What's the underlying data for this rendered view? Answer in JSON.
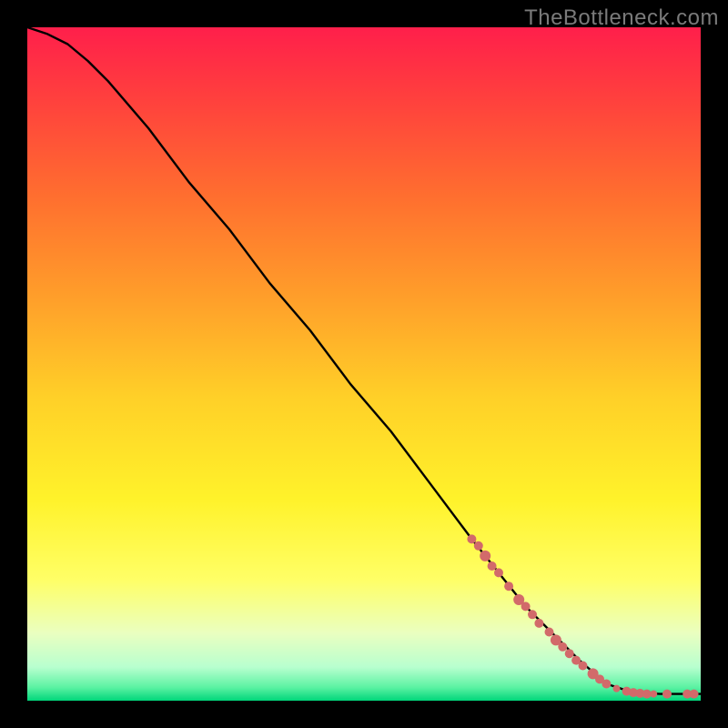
{
  "watermark": "TheBottleneck.com",
  "chart_data": {
    "type": "line",
    "title": "",
    "xlabel": "",
    "ylabel": "",
    "xlim": [
      0,
      100
    ],
    "ylim": [
      0,
      100
    ],
    "grid": false,
    "legend": false,
    "series": [
      {
        "name": "curve",
        "type": "line",
        "color": "#000000",
        "x": [
          0,
          3,
          6,
          9,
          12,
          18,
          24,
          30,
          36,
          42,
          48,
          54,
          60,
          66,
          70,
          74,
          78,
          82,
          86,
          90,
          94,
          97,
          100
        ],
        "y": [
          100,
          99,
          97.5,
          95,
          92,
          85,
          77,
          70,
          62,
          55,
          47,
          40,
          32,
          24,
          19,
          14,
          10,
          6,
          2.5,
          1.2,
          1.0,
          1.0,
          1.0
        ]
      },
      {
        "name": "markers",
        "type": "scatter",
        "color": "#d26a6a",
        "points": [
          {
            "x": 66.0,
            "y": 24.0,
            "r": 5
          },
          {
            "x": 67.0,
            "y": 23.0,
            "r": 5
          },
          {
            "x": 68.0,
            "y": 21.5,
            "r": 6
          },
          {
            "x": 69.0,
            "y": 20.0,
            "r": 5
          },
          {
            "x": 70.0,
            "y": 19.0,
            "r": 5
          },
          {
            "x": 71.5,
            "y": 17.0,
            "r": 5
          },
          {
            "x": 73.0,
            "y": 15.0,
            "r": 6
          },
          {
            "x": 74.0,
            "y": 14.0,
            "r": 5
          },
          {
            "x": 75.0,
            "y": 12.8,
            "r": 5
          },
          {
            "x": 76.0,
            "y": 11.5,
            "r": 5
          },
          {
            "x": 77.5,
            "y": 10.2,
            "r": 5
          },
          {
            "x": 78.5,
            "y": 9.0,
            "r": 6
          },
          {
            "x": 79.5,
            "y": 8.0,
            "r": 5
          },
          {
            "x": 80.5,
            "y": 7.0,
            "r": 5
          },
          {
            "x": 81.5,
            "y": 6.0,
            "r": 5
          },
          {
            "x": 82.5,
            "y": 5.2,
            "r": 5
          },
          {
            "x": 84.0,
            "y": 4.0,
            "r": 6
          },
          {
            "x": 85.0,
            "y": 3.2,
            "r": 5
          },
          {
            "x": 86.0,
            "y": 2.5,
            "r": 5
          },
          {
            "x": 87.5,
            "y": 1.8,
            "r": 4
          },
          {
            "x": 89.0,
            "y": 1.4,
            "r": 5
          },
          {
            "x": 90.0,
            "y": 1.2,
            "r": 5
          },
          {
            "x": 91.0,
            "y": 1.1,
            "r": 5
          },
          {
            "x": 92.0,
            "y": 1.0,
            "r": 5
          },
          {
            "x": 93.0,
            "y": 1.0,
            "r": 4
          },
          {
            "x": 95.0,
            "y": 1.0,
            "r": 5
          },
          {
            "x": 98.0,
            "y": 1.0,
            "r": 5
          },
          {
            "x": 99.0,
            "y": 1.0,
            "r": 5
          }
        ]
      }
    ],
    "background_gradient": {
      "stops": [
        {
          "offset": 0.0,
          "color": "#ff1f4b"
        },
        {
          "offset": 0.1,
          "color": "#ff3e3e"
        },
        {
          "offset": 0.25,
          "color": "#ff6e2f"
        },
        {
          "offset": 0.4,
          "color": "#ff9e2a"
        },
        {
          "offset": 0.55,
          "color": "#ffd028"
        },
        {
          "offset": 0.7,
          "color": "#fff22a"
        },
        {
          "offset": 0.82,
          "color": "#ffff66"
        },
        {
          "offset": 0.9,
          "color": "#eaffc0"
        },
        {
          "offset": 0.95,
          "color": "#b8ffcf"
        },
        {
          "offset": 0.98,
          "color": "#5cf2a3"
        },
        {
          "offset": 1.0,
          "color": "#00d67a"
        }
      ]
    }
  }
}
